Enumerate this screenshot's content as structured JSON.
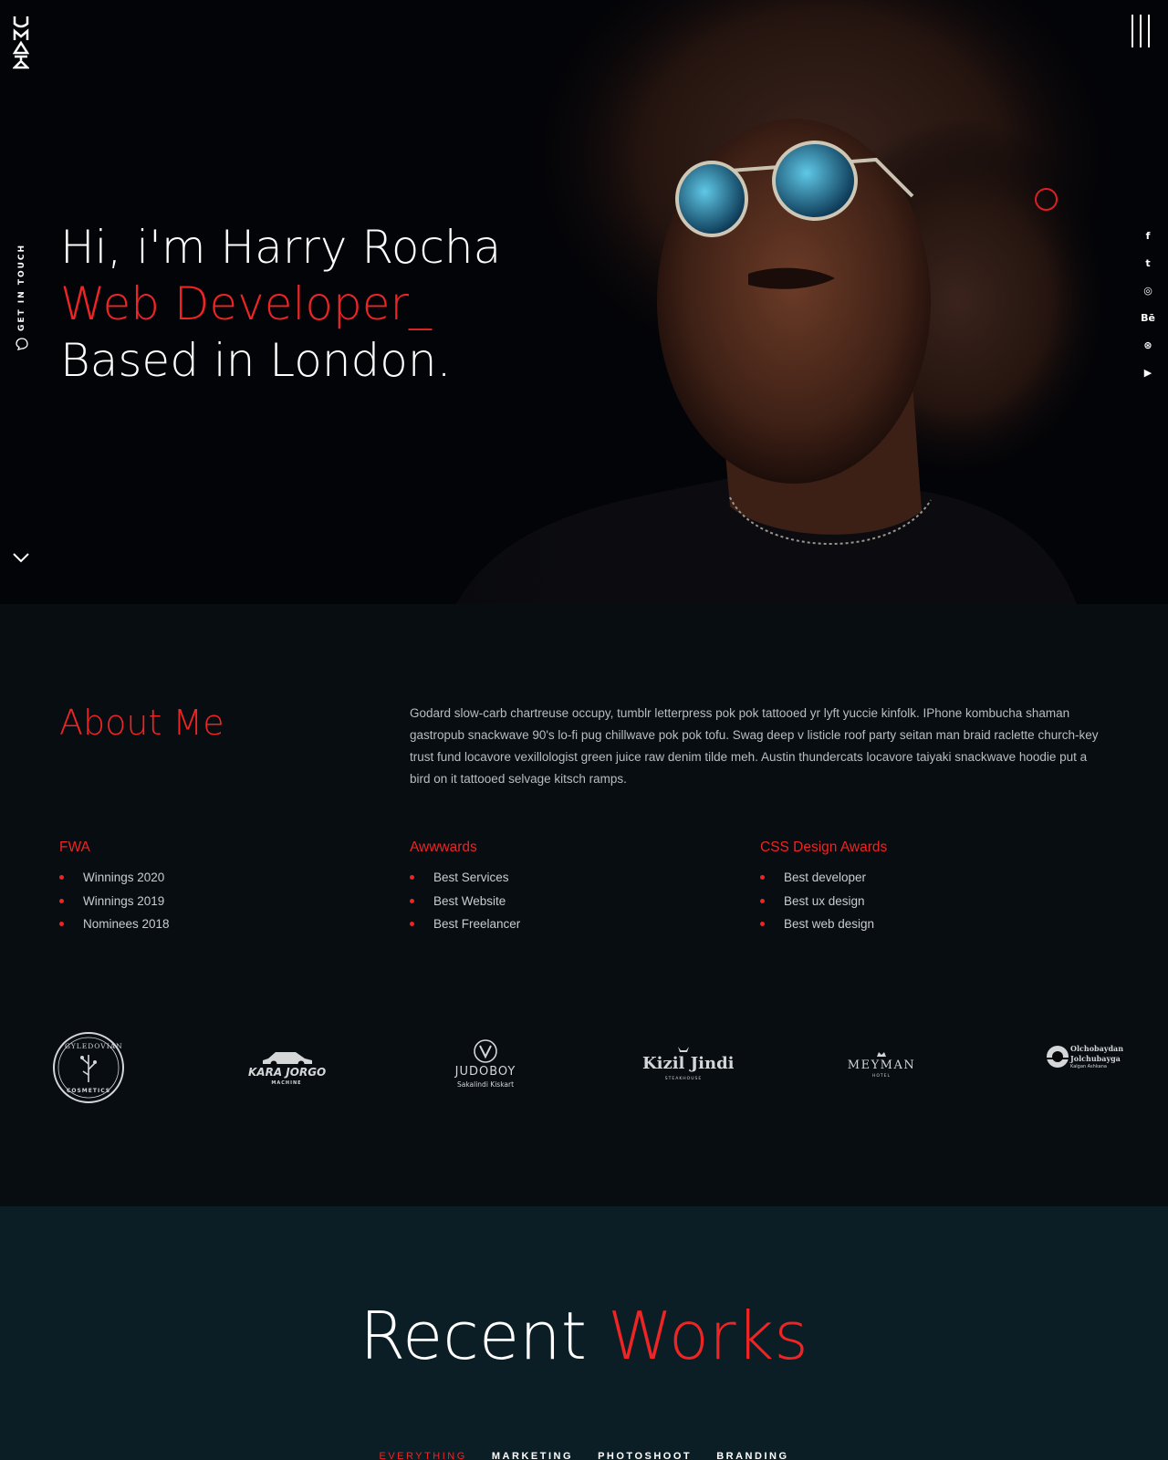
{
  "colors": {
    "accent": "#ef2424",
    "hero_bg": "#030408",
    "about_bg": "#070d10",
    "works_bg": "#0b1e25"
  },
  "brand": {
    "logo_text": "UMAYA"
  },
  "hero": {
    "line1": "Hi, i'm Harry Rocha",
    "line2": "Web Developer_",
    "line3": "Based in London.",
    "contact_label": "GET IN TOUCH",
    "social": [
      {
        "icon": "facebook-icon",
        "glyph": "f"
      },
      {
        "icon": "twitter-icon",
        "glyph": "t"
      },
      {
        "icon": "instagram-icon",
        "glyph": "◎"
      },
      {
        "icon": "behance-icon",
        "glyph": "Bē"
      },
      {
        "icon": "dribbble-icon",
        "glyph": "⊛"
      },
      {
        "icon": "youtube-icon",
        "glyph": "▶"
      }
    ]
  },
  "about": {
    "title": "About Me",
    "text": "Godard slow-carb chartreuse occupy, tumblr letterpress pok pok tattooed yr lyft yuccie kinfolk. IPhone kombucha shaman gastropub snackwave 90's lo-fi pug chillwave pok pok tofu. Swag deep v listicle roof party seitan man braid raclette church-key trust fund locavore vexillologist green juice raw denim tilde meh. Austin thundercats locavore taiyaki snackwave hoodie put a bird on it tattooed selvage kitsch ramps.",
    "awards": [
      {
        "title": "FWA",
        "items": [
          "Winnings 2020",
          "Winnings 2019",
          "Nominees 2018"
        ]
      },
      {
        "title": "Awwwards",
        "items": [
          "Best Services",
          "Best Website",
          "Best Freelancer"
        ]
      },
      {
        "title": "CSS Design Awards",
        "items": [
          "Best developer",
          "Best ux design",
          "Best web design"
        ]
      }
    ]
  },
  "clients": {
    "c1": {
      "top": "GYLEDOVIAN",
      "bottom": "COSMETICS"
    },
    "c2": {
      "name": "KARA JORGO",
      "sub": "MACHINE"
    },
    "c3": {
      "name": "JUDOBOY",
      "sub": "Sakalindi Kiskart"
    },
    "c4": {
      "name": "Kizil Jindi",
      "sub": "STEAKHOUSE"
    },
    "c5": {
      "name": "MEYMAN",
      "sub": "HOTEL"
    },
    "c6": {
      "l1": "Olchobaydan",
      "l2": "Jolchubayga",
      "l3": "Kalgan Ashkana"
    }
  },
  "works": {
    "title_a": "Recent",
    "title_b": "Works",
    "filters": [
      "EVERYTHING",
      "MARKETING",
      "PHOTOSHOOT",
      "BRANDING"
    ]
  }
}
